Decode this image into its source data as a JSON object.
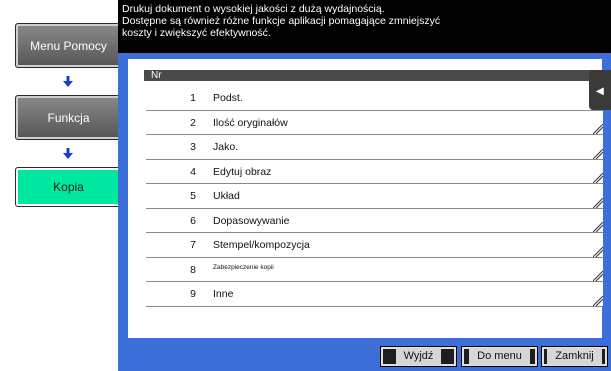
{
  "sidebar": {
    "buttons": [
      {
        "label": "Menu Pomocy",
        "active": false
      },
      {
        "label": "Funkcja",
        "active": false
      },
      {
        "label": "Kopia",
        "active": true
      }
    ],
    "arrow_icon": "down-arrow-icon"
  },
  "header": {
    "line1": "Drukuj dokument o wysokiej jakości z dużą wydajnością.",
    "line2": "Dostępne są również różne funkcje aplikacji pomagające zmniejszyć",
    "line3": "koszty i zwiększyć efektywność."
  },
  "list": {
    "column_header": "Nr",
    "rows": [
      {
        "num": "1",
        "label": "Podst."
      },
      {
        "num": "2",
        "label": "Ilość oryginałów"
      },
      {
        "num": "3",
        "label": "Jako."
      },
      {
        "num": "4",
        "label": "Edytuj obraz"
      },
      {
        "num": "5",
        "label": "Układ"
      },
      {
        "num": "6",
        "label": "Dopasowywanie"
      },
      {
        "num": "7",
        "label": "Stempel/kompozycja"
      },
      {
        "num": "8",
        "label": "Zabezpieczenie kopii"
      },
      {
        "num": "9",
        "label": "Inne"
      }
    ]
  },
  "side_tab": {
    "icon": "collapse-left-icon",
    "glyph": "◂"
  },
  "footer": {
    "exit": "Wyjdź",
    "to_menu": "Do menu",
    "close": "Zamknij"
  },
  "colors": {
    "frame_blue": "#3d6fd8",
    "active_green": "#00e8a0",
    "header_black": "#000000"
  }
}
